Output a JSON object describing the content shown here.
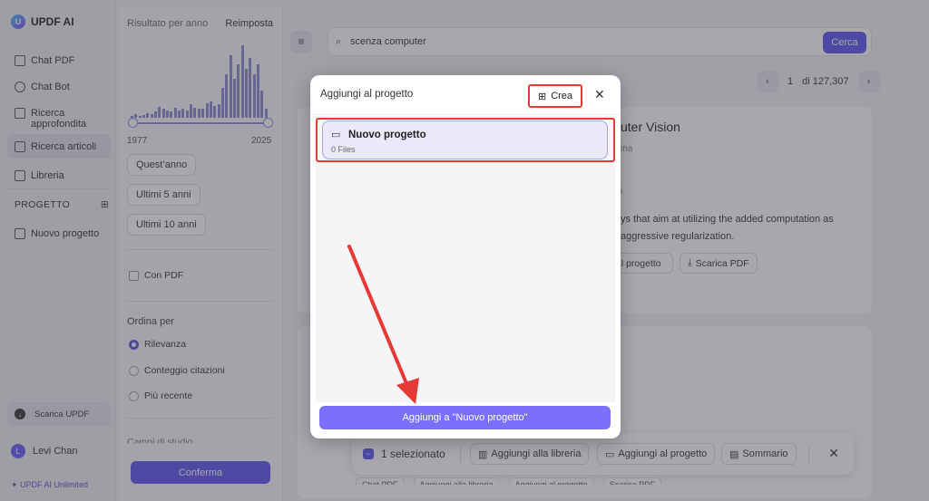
{
  "app": {
    "name": "UPDF AI",
    "logo_letter": "U"
  },
  "sidebar": {
    "items": [
      {
        "label": "Chat PDF",
        "icon": "book-icon"
      },
      {
        "label": "Chat Bot",
        "icon": "bot-icon"
      },
      {
        "label": "Ricerca\napprofondita",
        "icon": "telescope-icon"
      },
      {
        "label": "Ricerca articoli",
        "icon": "search-icon",
        "active": true
      },
      {
        "label": "Libreria",
        "icon": "library-icon"
      }
    ],
    "project_header": "PROGETTO",
    "projects": [
      {
        "label": "Nuovo progetto"
      }
    ],
    "download_label": "Scarica UPDF",
    "user_name": "Levi Chan",
    "user_initial": "L",
    "plan_label": "UPDF AI Unlimited"
  },
  "filters": {
    "title": "Risultato per anno",
    "reset": "Reimposta",
    "year_start": "1977",
    "year_end": "2025",
    "histogram": [
      0.02,
      0.05,
      0.03,
      0.04,
      0.06,
      0.05,
      0.08,
      0.15,
      0.12,
      0.1,
      0.08,
      0.14,
      0.1,
      0.12,
      0.1,
      0.18,
      0.13,
      0.12,
      0.12,
      0.2,
      0.22,
      0.16,
      0.18,
      0.4,
      0.58,
      0.84,
      0.52,
      0.72,
      0.97,
      0.66,
      0.8,
      0.58,
      0.72,
      0.37,
      0.12
    ],
    "chips": [
      "Quest’anno",
      "Ultimi 5 anni",
      "Ultimi 10 anni"
    ],
    "with_pdf": "Con PDF",
    "sort_title": "Ordina per",
    "sort_options": [
      "Rilevanza",
      "Conteggio citazioni",
      "Più recente"
    ],
    "sort_selected": 0,
    "fields_title": "Campi di studio",
    "confirm": "Conferma"
  },
  "search": {
    "query": "scenza computer",
    "button": "Cerca"
  },
  "pager": {
    "page": "1",
    "of": "di 127,307"
  },
  "card": {
    "title_fragment": "uter Vision",
    "meta1": "ina",
    "meta2": "i",
    "text1": "ys that aim at utilizing the added computation as",
    "text2": "aggressive regularization.",
    "btn_project": "al progetto",
    "btn_download": "Scarica PDF"
  },
  "bottom_bar": {
    "count": "1 selezionato",
    "add_library": "Aggiungi alla libreria",
    "add_project": "Aggiungi al progetto",
    "summary": "Sommario",
    "ghost": [
      "Chat PDF",
      "Aggiungi alla libreria",
      "Aggiungi al progetto",
      "Scarica PDF"
    ]
  },
  "modal": {
    "title": "Aggiungi al progetto",
    "create": "Crea",
    "project_name": "Nuovo progetto",
    "project_files": "0 Files",
    "add_button": "Aggiungi a \"Nuovo progetto\""
  },
  "colors": {
    "accent": "#5f55f0",
    "highlight": "#e53935"
  }
}
